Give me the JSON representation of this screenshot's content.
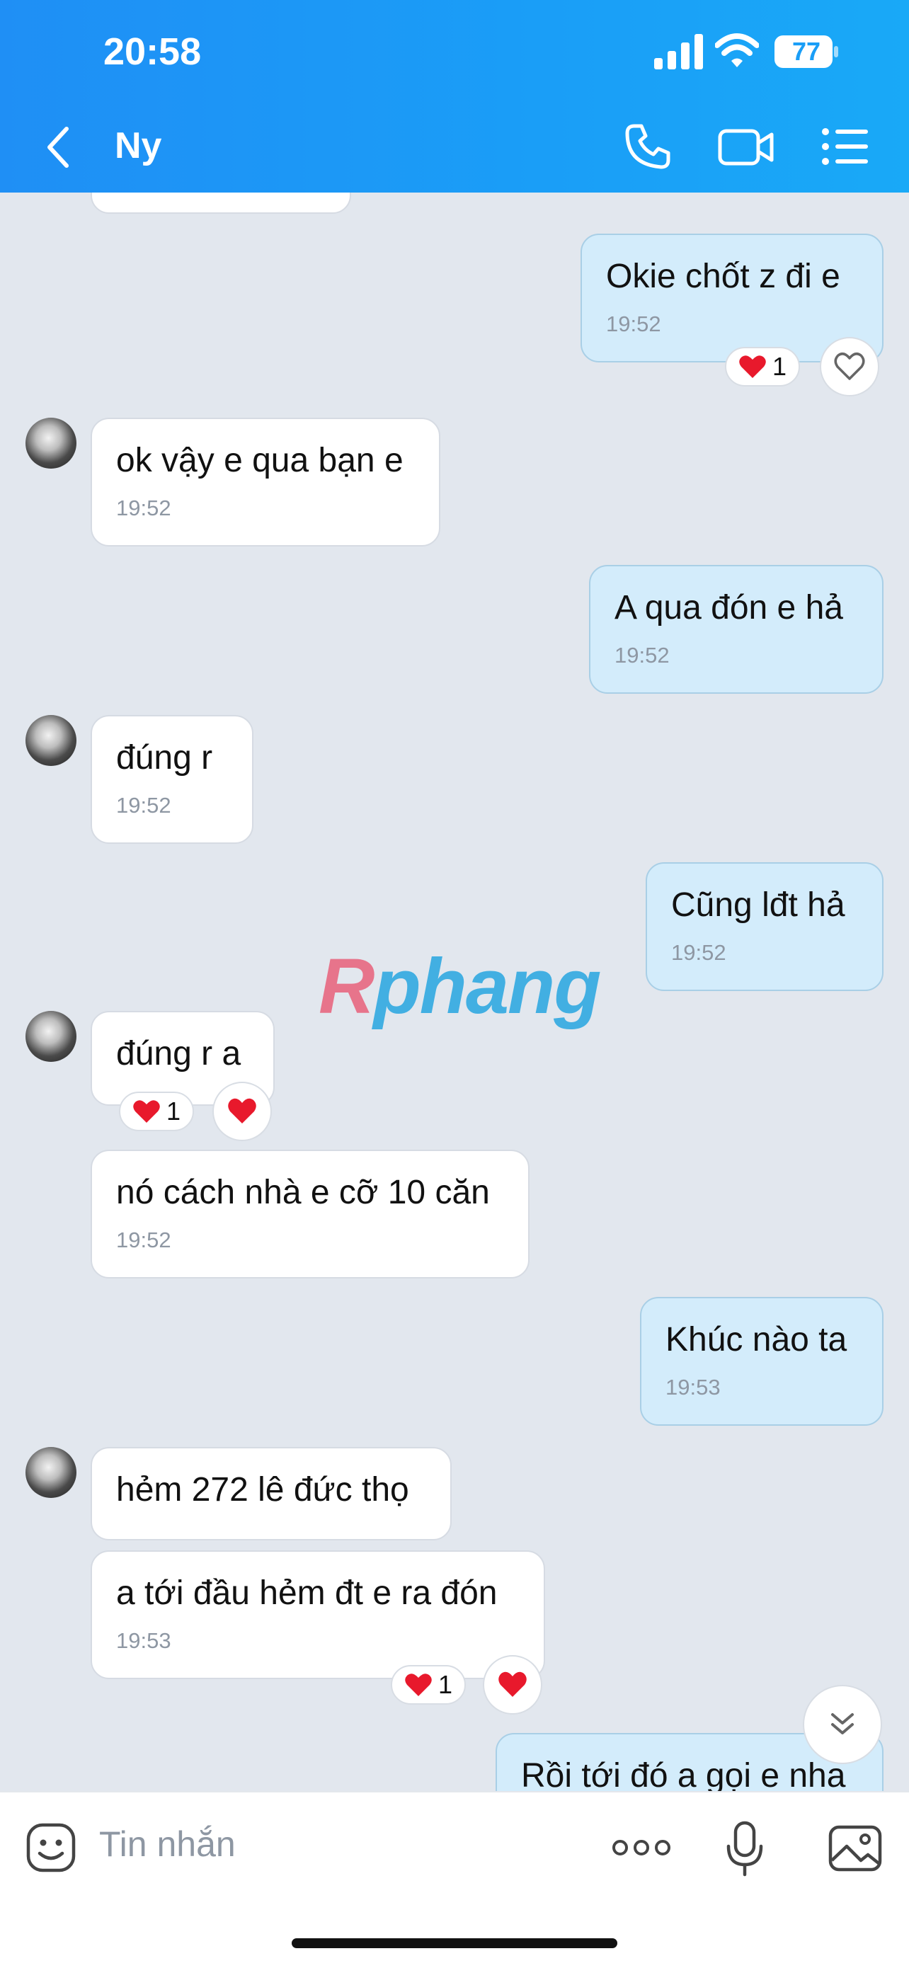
{
  "status": {
    "time": "20:58",
    "battery": "77"
  },
  "header": {
    "title": "Ny"
  },
  "messages": [
    {
      "text": "Okie chốt z đi e",
      "time": "19:52",
      "reaction_count": "1"
    },
    {
      "text": "ok vậy e qua bạn e",
      "time": "19:52"
    },
    {
      "text": "A qua đón e hả",
      "time": "19:52"
    },
    {
      "text": "đúng r",
      "time": "19:52"
    },
    {
      "text": "Cũng lđt hả",
      "time": "19:52"
    },
    {
      "text": "đúng r a",
      "reaction_count": "1"
    },
    {
      "text": "nó cách nhà e cỡ 10 căn",
      "time": "19:52"
    },
    {
      "text": "Khúc nào ta",
      "time": "19:53"
    },
    {
      "text": "hẻm 272 lê đức thọ"
    },
    {
      "text": "a tới đầu hẻm đt e ra đón",
      "time": "19:53",
      "reaction_count": "1"
    },
    {
      "text": "Rồi tới đó a gọi e nha"
    }
  ],
  "watermark": {
    "part1": "R",
    "part2": "phang"
  },
  "composer": {
    "placeholder": "Tin nhắn"
  },
  "colors": {
    "header": "#1a9ef7",
    "outgoing": "#d3ecfb",
    "incoming": "#ffffff",
    "background": "#e2e7ee",
    "heart": "#e8192c"
  }
}
